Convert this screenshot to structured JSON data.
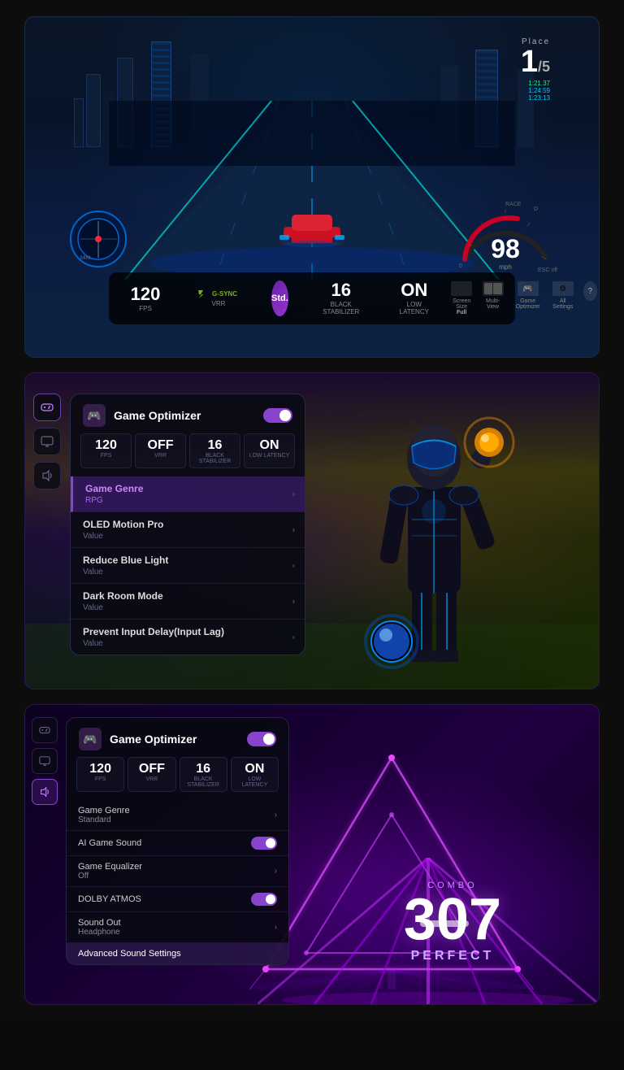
{
  "page": {
    "bg_color": "#0a0a0a"
  },
  "panel1": {
    "race_position": "1",
    "race_total": "5",
    "place_label": "Place",
    "lap_times": [
      "1:21.37",
      "1:24.59",
      "1:23:13"
    ],
    "speed": "98",
    "speed_unit": "mph",
    "fps_value": "120",
    "fps_label": "FPS",
    "vrr_label": "G-SYNC VRR",
    "mode_label": "Std.",
    "black_stab_value": "16",
    "black_stab_label": "Black Stabilizer",
    "latency_value": "ON",
    "latency_label": "Low Latency",
    "actions": [
      "Full",
      "Multi-View",
      "Game Optimizer",
      "All Settings"
    ],
    "actions_labels": [
      "Screen Size",
      "Multi-View",
      "Game Optimizer",
      "All Settings"
    ]
  },
  "panel2": {
    "title": "Game Optimizer",
    "icon": "🎮",
    "toggle_on": true,
    "stats": [
      {
        "value": "120",
        "unit": "FPS"
      },
      {
        "value": "OFF",
        "unit": "VRR"
      },
      {
        "value": "16",
        "unit": "Black Stabilizer"
      },
      {
        "value": "ON",
        "unit": "Low Latency"
      }
    ],
    "menu_items": [
      {
        "title": "Game Genre",
        "value": "RPG",
        "highlighted": true
      },
      {
        "title": "OLED Motion Pro",
        "value": "Value",
        "highlighted": false
      },
      {
        "title": "Reduce Blue Light",
        "value": "Value",
        "highlighted": false
      },
      {
        "title": "Dark Room Mode",
        "value": "Value",
        "highlighted": false
      },
      {
        "title": "Prevent Input Delay(Input Lag)",
        "value": "Value",
        "highlighted": false
      }
    ]
  },
  "panel3": {
    "title": "Game Optimizer",
    "icon": "🎮",
    "toggle_on": true,
    "stats": [
      {
        "value": "120",
        "unit": "FPS"
      },
      {
        "value": "OFF",
        "unit": "VRR"
      },
      {
        "value": "16",
        "unit": "Black Stabilizer"
      },
      {
        "value": "ON",
        "unit": "Low Latency"
      }
    ],
    "menu_items": [
      {
        "title": "Game Genre",
        "value": "Standard",
        "type": "arrow"
      },
      {
        "title": "AI Game Sound",
        "value": "",
        "type": "toggle_on"
      },
      {
        "title": "Game Equalizer",
        "value": "Off",
        "type": "arrow"
      },
      {
        "title": "DOLBY ATMOS",
        "value": "",
        "type": "toggle_on"
      },
      {
        "title": "Sound Out",
        "value": "Headphone",
        "type": "arrow"
      },
      {
        "title": "Advanced Sound Settings",
        "value": "",
        "type": "highlighted"
      }
    ],
    "combo_label": "COMBO",
    "combo_number": "307",
    "combo_perfect": "PERFECT"
  }
}
